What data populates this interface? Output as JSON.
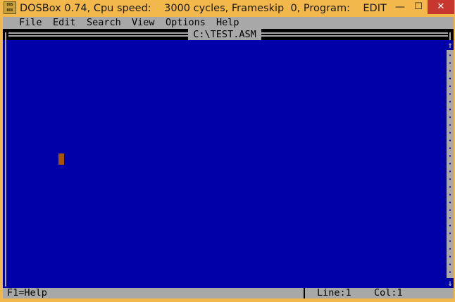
{
  "window": {
    "title": "DOSBox 0.74, Cpu speed:    3000 cycles, Frameskip  0, Program:    EDIT",
    "icon_text_1": "DOS",
    "icon_text_2": "BOX",
    "minimize_icon": "minimize-icon",
    "maximize_icon": "maximize-icon",
    "close_icon": "close-icon",
    "minimize_glyph": "—",
    "maximize_glyph": "☐",
    "close_glyph": "✕",
    "close_color": "#c7372f",
    "frame_color": "#f2b84b"
  },
  "menubar": {
    "items": [
      {
        "label": "File"
      },
      {
        "label": "Edit"
      },
      {
        "label": "Search"
      },
      {
        "label": "View"
      },
      {
        "label": "Options"
      },
      {
        "label": "Help"
      }
    ]
  },
  "editor": {
    "document_title": "C:\\TEST.ASM",
    "background_color": "#0000a8",
    "cursor_color": "#a85400",
    "scroll_up_glyph": "↑",
    "scroll_down_glyph": "↓"
  },
  "statusbar": {
    "help": "F1=Help",
    "line": "Line:1",
    "col": "Col:1"
  }
}
